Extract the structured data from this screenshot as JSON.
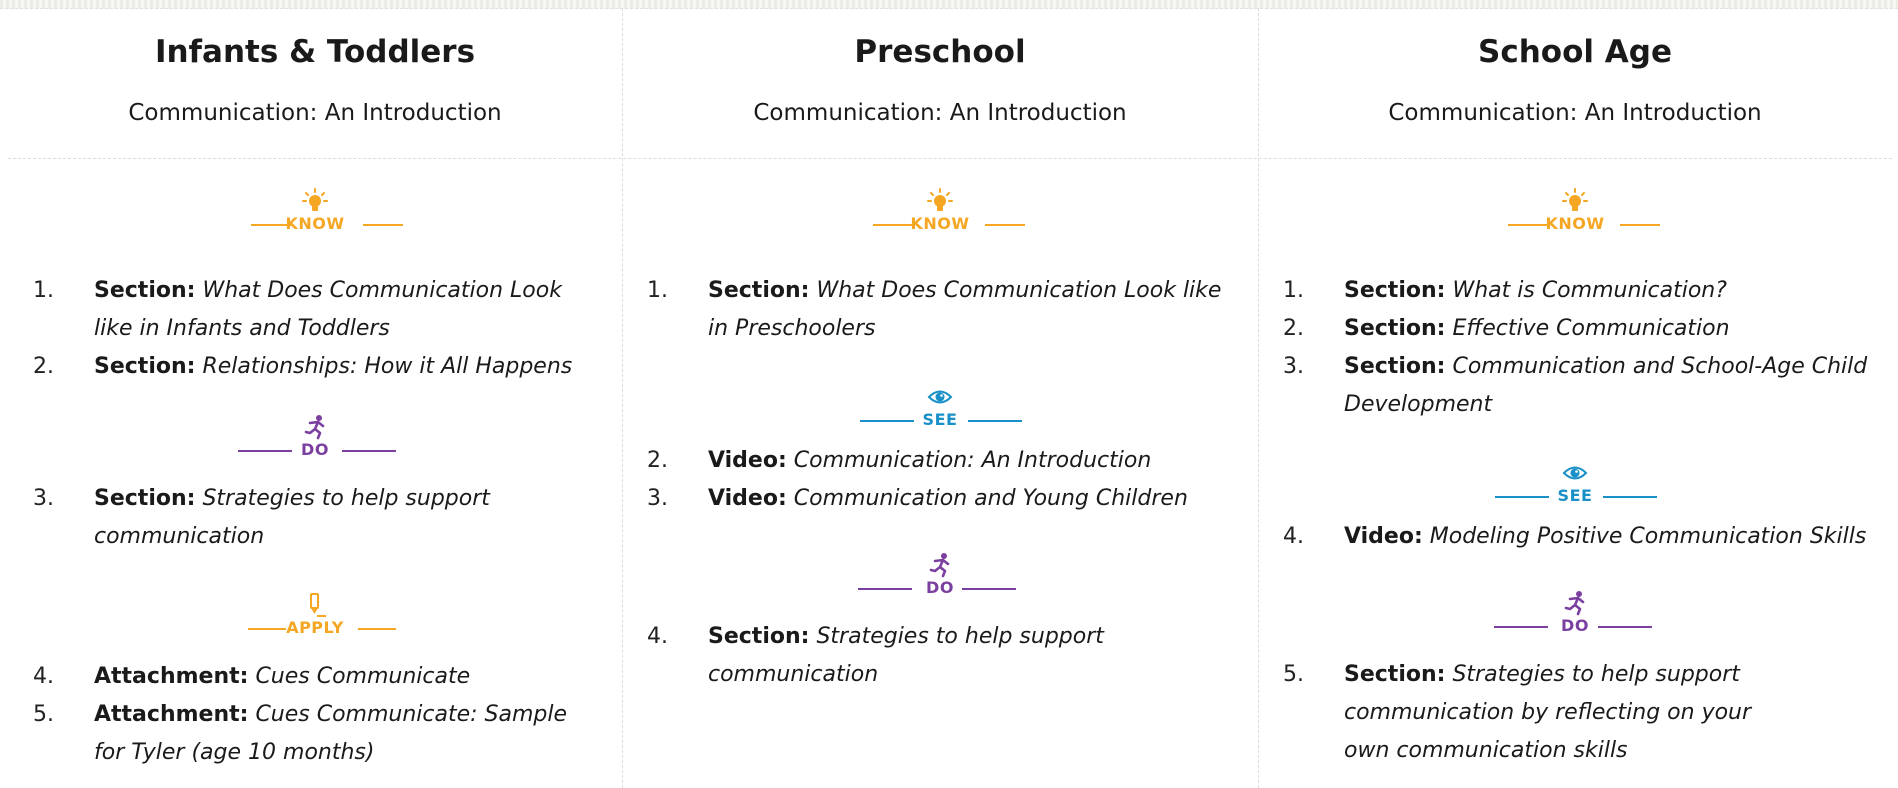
{
  "columns": [
    {
      "heading": "Infants & Toddlers",
      "subtitle": "Communication: An Introduction",
      "groups": [
        {
          "badge": "KNOW",
          "icon": "lightbulb-icon",
          "color": "#f5a623",
          "items": [
            {
              "num": "1.",
              "kind": "Section:",
              "title": "What Does Communication Look like in Infants and Toddlers"
            },
            {
              "num": "2.",
              "kind": "Section:",
              "title": "Relationships: How it All Happens"
            }
          ]
        },
        {
          "badge": "DO",
          "icon": "running-person-icon",
          "color": "#7b3fa0",
          "items": [
            {
              "num": "3.",
              "kind": "Section:",
              "title": "Strategies to help support communication"
            }
          ]
        },
        {
          "badge": "APPLY",
          "icon": "pencil-icon",
          "color": "#f5a623",
          "items": [
            {
              "num": "4.",
              "kind": "Attachment:",
              "title": "Cues Communicate"
            },
            {
              "num": "5.",
              "kind": "Attachment:",
              "title": "Cues Communicate: Sample for Tyler (age 10 months)"
            }
          ]
        }
      ]
    },
    {
      "heading": "Preschool",
      "subtitle": "Communication: An Introduction",
      "groups": [
        {
          "badge": "KNOW",
          "icon": "lightbulb-icon",
          "color": "#f5a623",
          "items": [
            {
              "num": "1.",
              "kind": "Section:",
              "title": "What Does Communication Look like in Preschoolers"
            }
          ]
        },
        {
          "badge": "SEE",
          "icon": "eye-icon",
          "color": "#1a90c8",
          "items": [
            {
              "num": "2.",
              "kind": "Video:",
              "title": "Communication: An Introduction"
            },
            {
              "num": "3.",
              "kind": "Video:",
              "title": "Communication and Young Children"
            }
          ]
        },
        {
          "badge": "DO",
          "icon": "running-person-icon",
          "color": "#7b3fa0",
          "items": [
            {
              "num": "4.",
              "kind": "Section:",
              "title": "Strategies to help support communication"
            }
          ]
        }
      ]
    },
    {
      "heading": "School Age",
      "subtitle": "Communication: An Introduction",
      "groups": [
        {
          "badge": "KNOW",
          "icon": "lightbulb-icon",
          "color": "#f5a623",
          "items": [
            {
              "num": "1.",
              "kind": "Section:",
              "title": "What is Communication?"
            },
            {
              "num": "2.",
              "kind": "Section:",
              "title": "Effective Communication"
            },
            {
              "num": "3.",
              "kind": "Section:",
              "title": "Communication and School-Age Child Development"
            }
          ]
        },
        {
          "badge": "SEE",
          "icon": "eye-icon",
          "color": "#1a90c8",
          "items": [
            {
              "num": "4.",
              "kind": "Video:",
              "title": "Modeling Positive Communication Skills"
            }
          ]
        },
        {
          "badge": "DO",
          "icon": "running-person-icon",
          "color": "#7b3fa0",
          "items": [
            {
              "num": "5.",
              "kind": "Section:",
              "title": "Strategies to help support communication by reflecting on your own communication skills"
            }
          ]
        }
      ]
    }
  ]
}
